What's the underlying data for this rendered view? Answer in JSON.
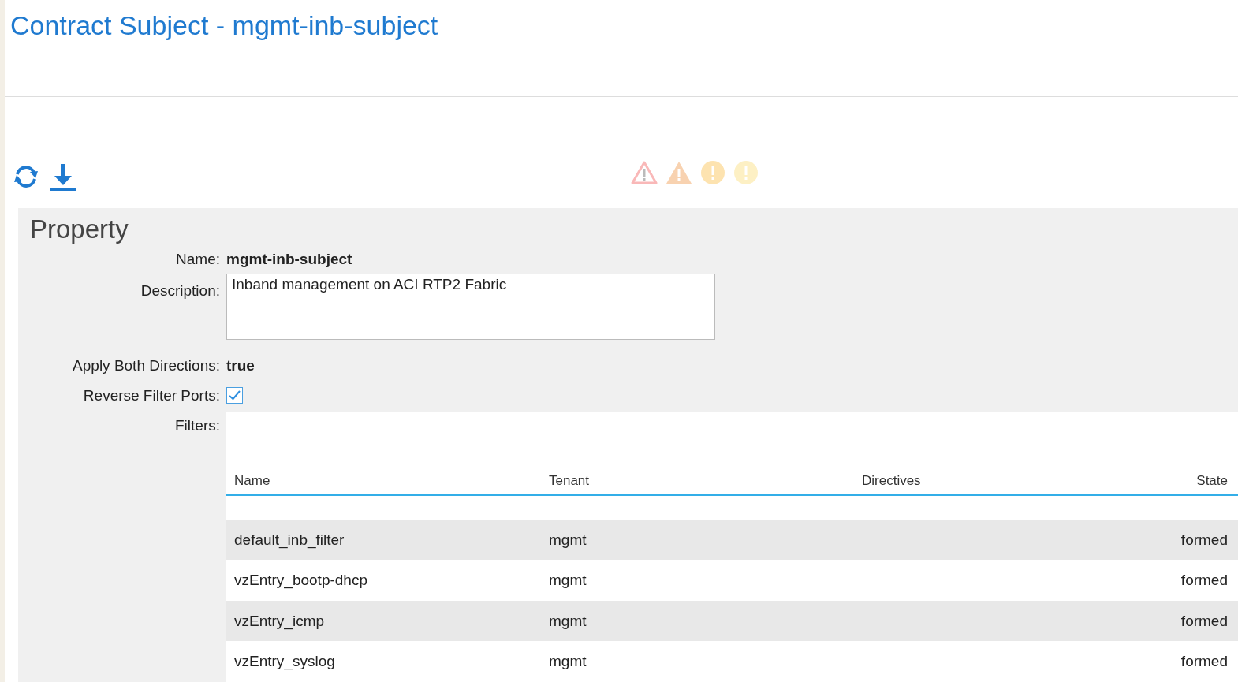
{
  "title": "Contract Subject - mgmt-inb-subject",
  "property": {
    "heading": "Property",
    "name_label": "Name:",
    "name_value": "mgmt-inb-subject",
    "description_label": "Description:",
    "description_value": "Inband management on ACI RTP2 Fabric",
    "apply_label": "Apply Both Directions:",
    "apply_value": "true",
    "reverse_label": "Reverse Filter Ports:",
    "reverse_checked": true,
    "filters_label": "Filters:"
  },
  "filters": {
    "columns": [
      "Name",
      "Tenant",
      "Directives",
      "State"
    ],
    "rows": [
      {
        "name": "default_inb_filter",
        "tenant": "mgmt",
        "state": "formed"
      },
      {
        "name": "vzEntry_bootp-dhcp",
        "tenant": "mgmt",
        "state": "formed"
      },
      {
        "name": "vzEntry_icmp",
        "tenant": "mgmt",
        "state": "formed"
      },
      {
        "name": "vzEntry_syslog",
        "tenant": "mgmt",
        "state": "formed"
      }
    ]
  }
}
